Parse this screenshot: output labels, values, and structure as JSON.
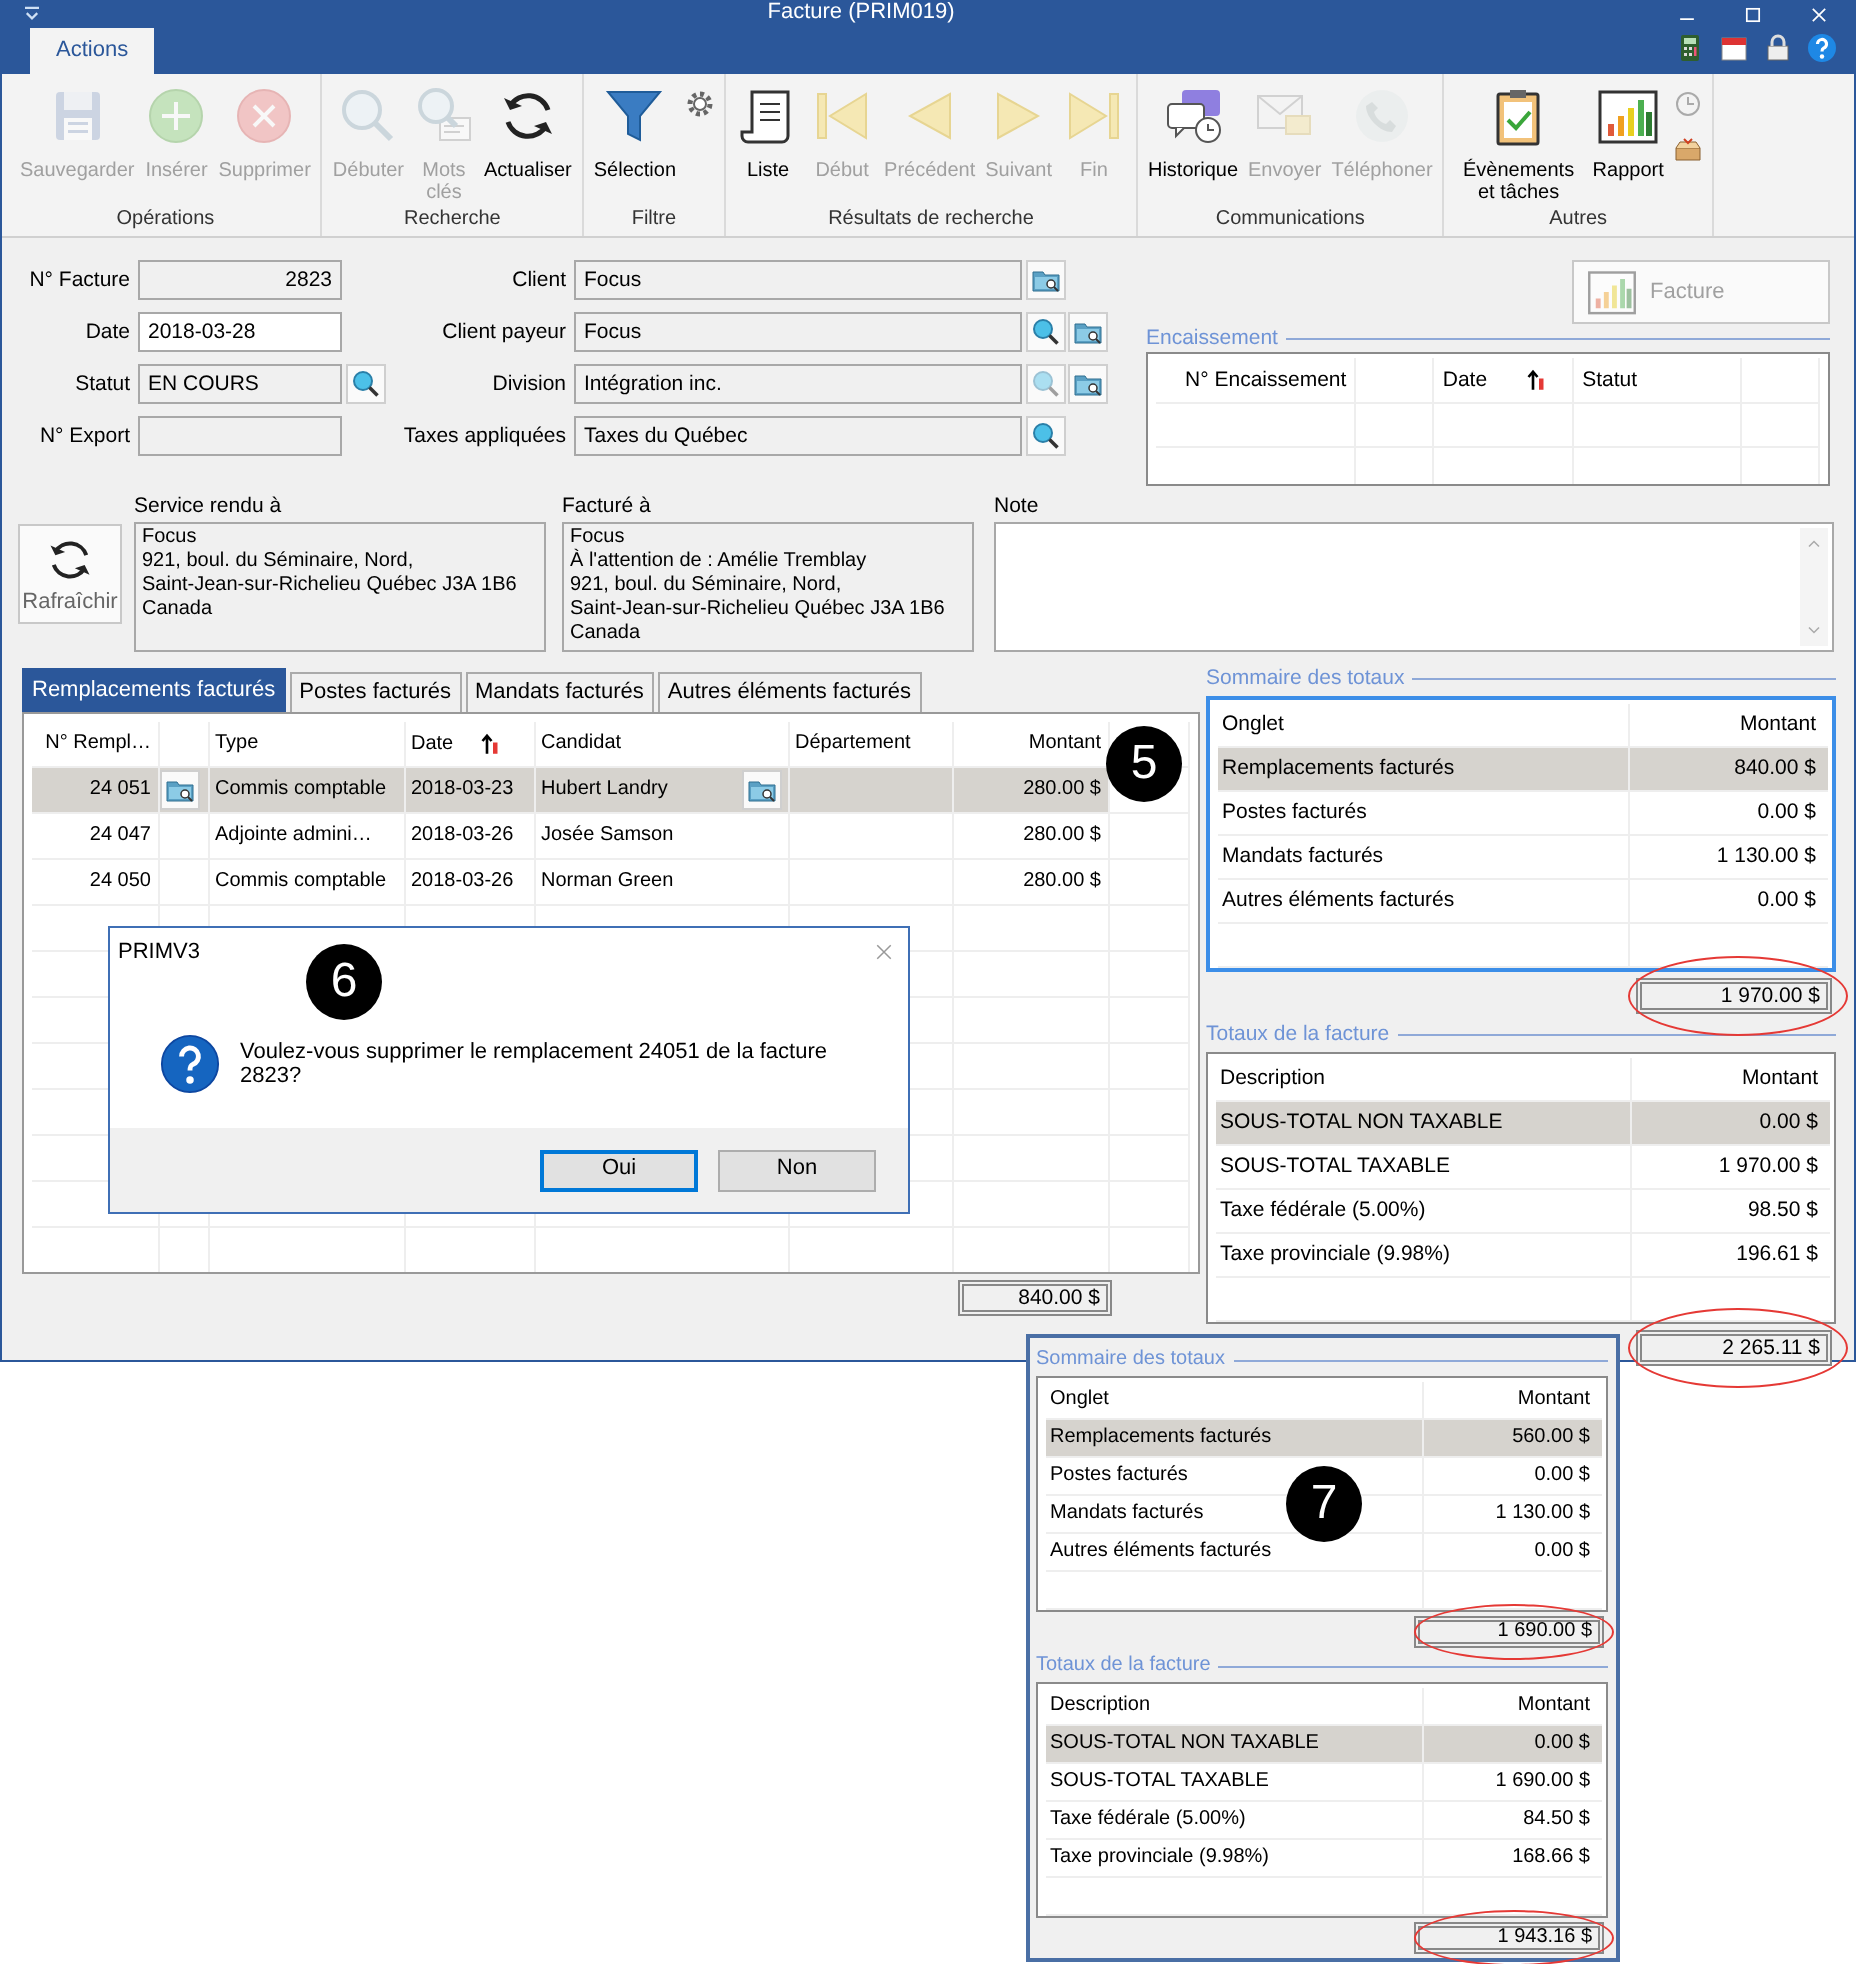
{
  "window": {
    "title": "Facture (PRIM019)"
  },
  "ribbon": {
    "tabs": [
      {
        "label": "Actions",
        "selected": true
      }
    ],
    "groups": [
      {
        "label": "Opérations",
        "buttons": [
          {
            "label": "Sauvegarder",
            "kind": "save",
            "disabled": true
          },
          {
            "label": "Insérer",
            "kind": "insert",
            "disabled": true
          },
          {
            "label": "Supprimer",
            "kind": "delete",
            "disabled": true
          }
        ]
      },
      {
        "label": "Recherche",
        "buttons": [
          {
            "label": "Débuter",
            "kind": "search",
            "disabled": true
          },
          {
            "label": "Mots clés",
            "kind": "keywords",
            "disabled": true
          },
          {
            "label": "Actualiser",
            "kind": "refresh",
            "disabled": false
          }
        ]
      },
      {
        "label": "Filtre",
        "buttons": [
          {
            "label": "Sélection",
            "kind": "filter",
            "disabled": false
          }
        ],
        "extras": [
          {
            "kind": "gear"
          }
        ]
      },
      {
        "label": "Résultats de recherche",
        "buttons": [
          {
            "label": "Liste",
            "kind": "list",
            "disabled": false
          },
          {
            "label": "Début",
            "kind": "first",
            "disabled": true
          },
          {
            "label": "Précédent",
            "kind": "prev",
            "disabled": true
          },
          {
            "label": "Suivant",
            "kind": "next",
            "disabled": true
          },
          {
            "label": "Fin",
            "kind": "last",
            "disabled": true
          }
        ]
      },
      {
        "label": "Communications",
        "buttons": [
          {
            "label": "Historique",
            "kind": "history",
            "disabled": false
          },
          {
            "label": "Envoyer",
            "kind": "send",
            "disabled": true
          },
          {
            "label": "Téléphoner",
            "kind": "phone",
            "disabled": true
          }
        ]
      },
      {
        "label": "Autres",
        "buttons": [
          {
            "label": "Évènements et tâches",
            "kind": "tasks",
            "disabled": false
          },
          {
            "label": "Rapport",
            "kind": "report",
            "disabled": false
          }
        ],
        "extras": [
          {
            "kind": "clock"
          },
          {
            "kind": "tray"
          }
        ]
      }
    ]
  },
  "form": {
    "fields": [
      {
        "label": "N° Facture",
        "value": "2823",
        "kind": "number",
        "editable": false
      },
      {
        "label": "Client",
        "value": "Focus",
        "kind": "text",
        "editable": false,
        "lookups": [
          {
            "kind": "folder",
            "disabled": false
          }
        ]
      },
      {
        "label": "Date",
        "value": "2018-03-28",
        "kind": "text",
        "editable": true
      },
      {
        "label": "Client payeur",
        "value": "Focus",
        "kind": "text",
        "editable": false,
        "lookups": [
          {
            "kind": "search",
            "disabled": false
          },
          {
            "kind": "folder",
            "disabled": false
          }
        ]
      },
      {
        "label": "Statut",
        "value": "EN COURS",
        "kind": "text",
        "editable": false,
        "lookups": [
          {
            "kind": "search",
            "disabled": false
          }
        ]
      },
      {
        "label": "Division",
        "value": "Intégration inc.",
        "kind": "text",
        "editable": false,
        "lookups": [
          {
            "kind": "search",
            "disabled": true
          },
          {
            "kind": "folder",
            "disabled": false
          }
        ]
      },
      {
        "label": "N° Export",
        "kind": "text",
        "editable": false
      },
      {
        "label": "Taxes appliquées",
        "value": "Taxes du Québec",
        "kind": "text",
        "editable": false,
        "lookups": [
          {
            "kind": "search",
            "disabled": false
          }
        ]
      }
    ],
    "report_button": {
      "label": "Facture",
      "disabled": true
    },
    "payments": {
      "title": "Encaissement",
      "columns": [
        {
          "label": "N° Encaissement",
          "sorted": false
        },
        {},
        {
          "label": "Date",
          "sorted": true
        },
        {
          "label": "Statut",
          "sorted": false
        },
        {}
      ]
    },
    "refresh_button": {
      "label": "Rafraîchir"
    },
    "addresses": [
      {
        "label": "Service rendu à",
        "lines": [
          "Focus",
          "921, boul. du Séminaire, Nord,",
          "Saint-Jean-sur-Richelieu Québec J3A 1B6",
          "Canada"
        ]
      },
      {
        "label": "Facturé à",
        "lines": [
          "Focus",
          "À l'attention de : Amélie Tremblay",
          "921, boul. du Séminaire, Nord,",
          "Saint-Jean-sur-Richelieu Québec J3A 1B6",
          "Canada"
        ]
      }
    ],
    "note": {
      "label": "Note"
    }
  },
  "detail_tabs": [
    {
      "label": "Remplacements facturés",
      "selected": true
    },
    {
      "label": "Postes facturés",
      "selected": false
    },
    {
      "label": "Mandats facturés",
      "selected": false
    },
    {
      "label": "Autres éléments facturés",
      "selected": false
    }
  ],
  "grid": {
    "callout": "5",
    "columns": [
      {
        "label": "N° Rempl…",
        "sorted": false
      },
      {},
      {
        "label": "Type",
        "sorted": false
      },
      {
        "label": "Date",
        "sorted": true
      },
      {
        "label": "Candidat",
        "sorted": false
      },
      {
        "label": "Département",
        "sorted": false
      },
      {
        "label": "Montant",
        "sorted": false
      },
      {}
    ],
    "rows": [
      {
        "selected": true,
        "number": "24 051",
        "type": "Commis comptable",
        "date": "2018-03-23",
        "candidate": "Hubert Landry",
        "amount": "280.00 $"
      },
      {
        "selected": false,
        "number": "24 047",
        "type": "Adjointe admini…",
        "date": "2018-03-26",
        "candidate": "Josée Samson",
        "amount": "280.00 $"
      },
      {
        "selected": false,
        "number": "24 050",
        "type": "Commis comptable",
        "date": "2018-03-26",
        "candidate": "Norman Green",
        "amount": "280.00 $"
      }
    ],
    "total": "840.00 $"
  },
  "dialog": {
    "callout": "6",
    "title": "PRIMV3",
    "message": "Voulez-vous supprimer le remplacement 24051 de la facture 2823?",
    "buttons": [
      {
        "label": "Oui",
        "default": true
      },
      {
        "label": "Non",
        "default": false
      }
    ]
  },
  "totals": {
    "summary": {
      "title": "Sommaire des totaux",
      "columns": [
        "Onglet",
        "Montant"
      ],
      "focused": true,
      "rows": [
        {
          "label": "Remplacements facturés",
          "amount": "840.00 $",
          "selected": true
        },
        {
          "label": "Postes facturés",
          "amount": "0.00 $",
          "selected": false
        },
        {
          "label": "Mandats facturés",
          "amount": "1 130.00 $",
          "selected": false
        },
        {
          "label": "Autres éléments facturés",
          "amount": "0.00 $",
          "selected": false
        }
      ],
      "total": "1 970.00 $",
      "circled": true
    },
    "invoice": {
      "title": "Totaux de la facture",
      "columns": [
        "Description",
        "Montant"
      ],
      "focused": false,
      "rows": [
        {
          "label": "SOUS-TOTAL NON TAXABLE",
          "amount": "0.00 $",
          "selected": true
        },
        {
          "label": "SOUS-TOTAL TAXABLE",
          "amount": "1 970.00 $",
          "selected": false
        },
        {
          "label": "Taxe fédérale (5.00%)",
          "amount": "98.50 $",
          "selected": false
        },
        {
          "label": "Taxe provinciale (9.98%)",
          "amount": "196.61 $",
          "selected": false
        }
      ],
      "total": "2 265.11 $",
      "circled": true
    }
  },
  "inset": {
    "callout": "7",
    "summary": {
      "title": "Sommaire des totaux",
      "columns": [
        "Onglet",
        "Montant"
      ],
      "focused": false,
      "rows": [
        {
          "label": "Remplacements facturés",
          "amount": "560.00 $",
          "selected": true
        },
        {
          "label": "Postes facturés",
          "amount": "0.00 $",
          "selected": false
        },
        {
          "label": "Mandats facturés",
          "amount": "1 130.00 $",
          "selected": false
        },
        {
          "label": "Autres éléments facturés",
          "amount": "0.00 $",
          "selected": false
        }
      ],
      "total": "1 690.00 $",
      "circled": true
    },
    "invoice": {
      "title": "Totaux de la facture",
      "columns": [
        "Description",
        "Montant"
      ],
      "focused": false,
      "rows": [
        {
          "label": "SOUS-TOTAL NON TAXABLE",
          "amount": "0.00 $",
          "selected": true
        },
        {
          "label": "SOUS-TOTAL TAXABLE",
          "amount": "1 690.00 $",
          "selected": false
        },
        {
          "label": "Taxe fédérale (5.00%)",
          "amount": "84.50 $",
          "selected": false
        },
        {
          "label": "Taxe provinciale (9.98%)",
          "amount": "168.66 $",
          "selected": false
        }
      ],
      "total": "1 943.16 $",
      "circled": true
    }
  }
}
